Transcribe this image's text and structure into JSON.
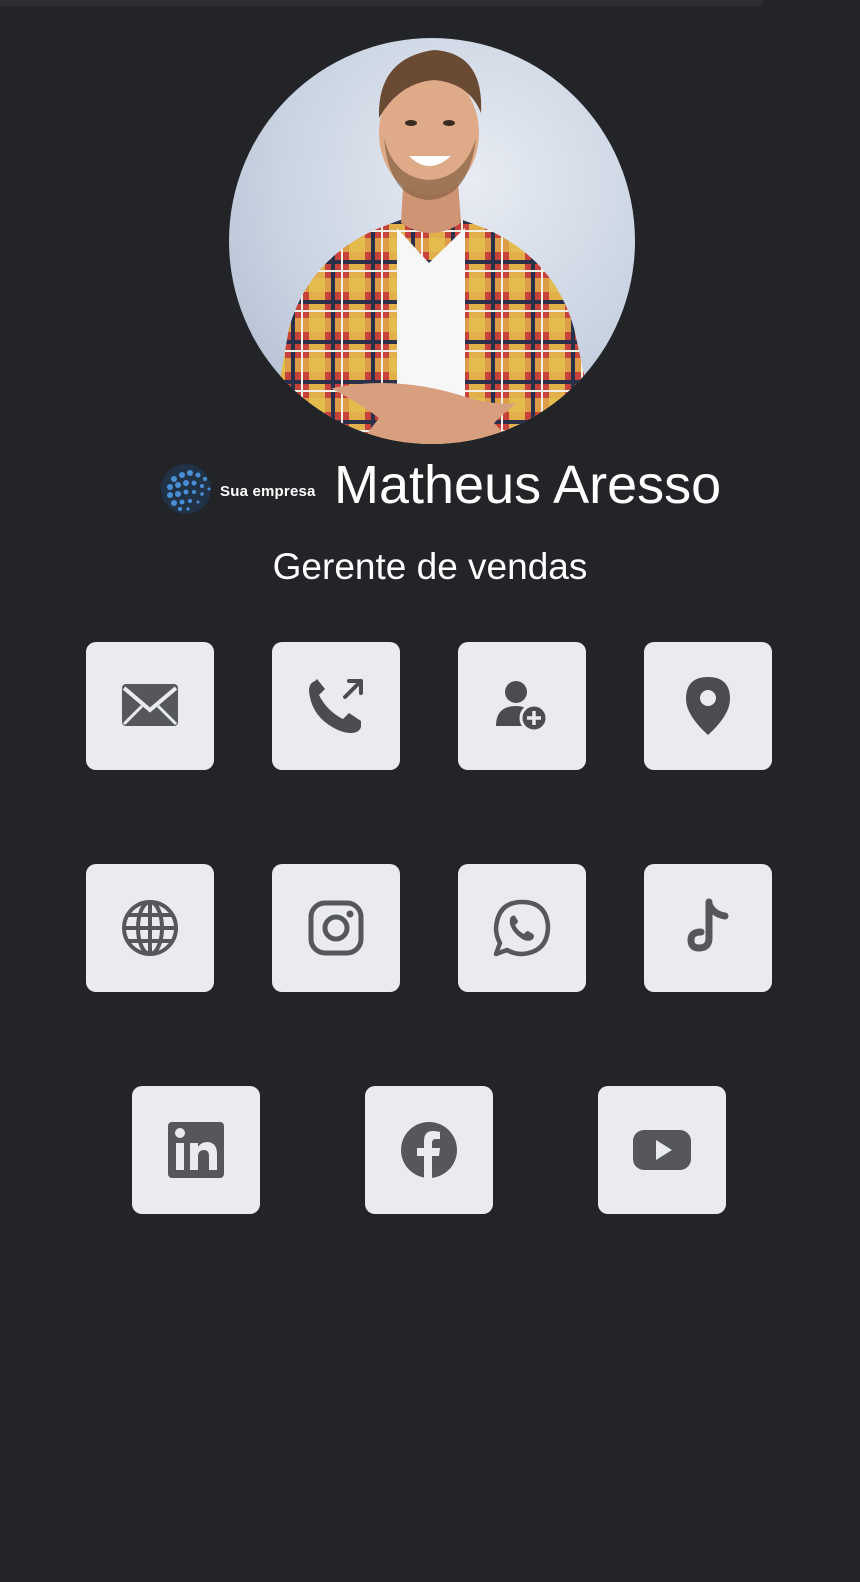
{
  "profile": {
    "name": "Matheus Aresso",
    "job_title": "Gerente de vendas",
    "company_logo_text": "Sua empresa"
  },
  "colors": {
    "background": "#222428",
    "tile": "#e9ebef",
    "icon": "#55575c",
    "logo_blue": "#3b7fc4"
  },
  "contact_buttons": [
    {
      "icon": "envelope-icon"
    },
    {
      "icon": "phone-outgoing-icon"
    },
    {
      "icon": "add-contact-icon"
    },
    {
      "icon": "map-pin-icon"
    },
    {
      "icon": "globe-icon"
    },
    {
      "icon": "instagram-icon"
    },
    {
      "icon": "whatsapp-icon"
    },
    {
      "icon": "tiktok-icon"
    },
    {
      "icon": "linkedin-icon"
    },
    {
      "icon": "facebook-icon"
    },
    {
      "icon": "youtube-icon"
    }
  ]
}
